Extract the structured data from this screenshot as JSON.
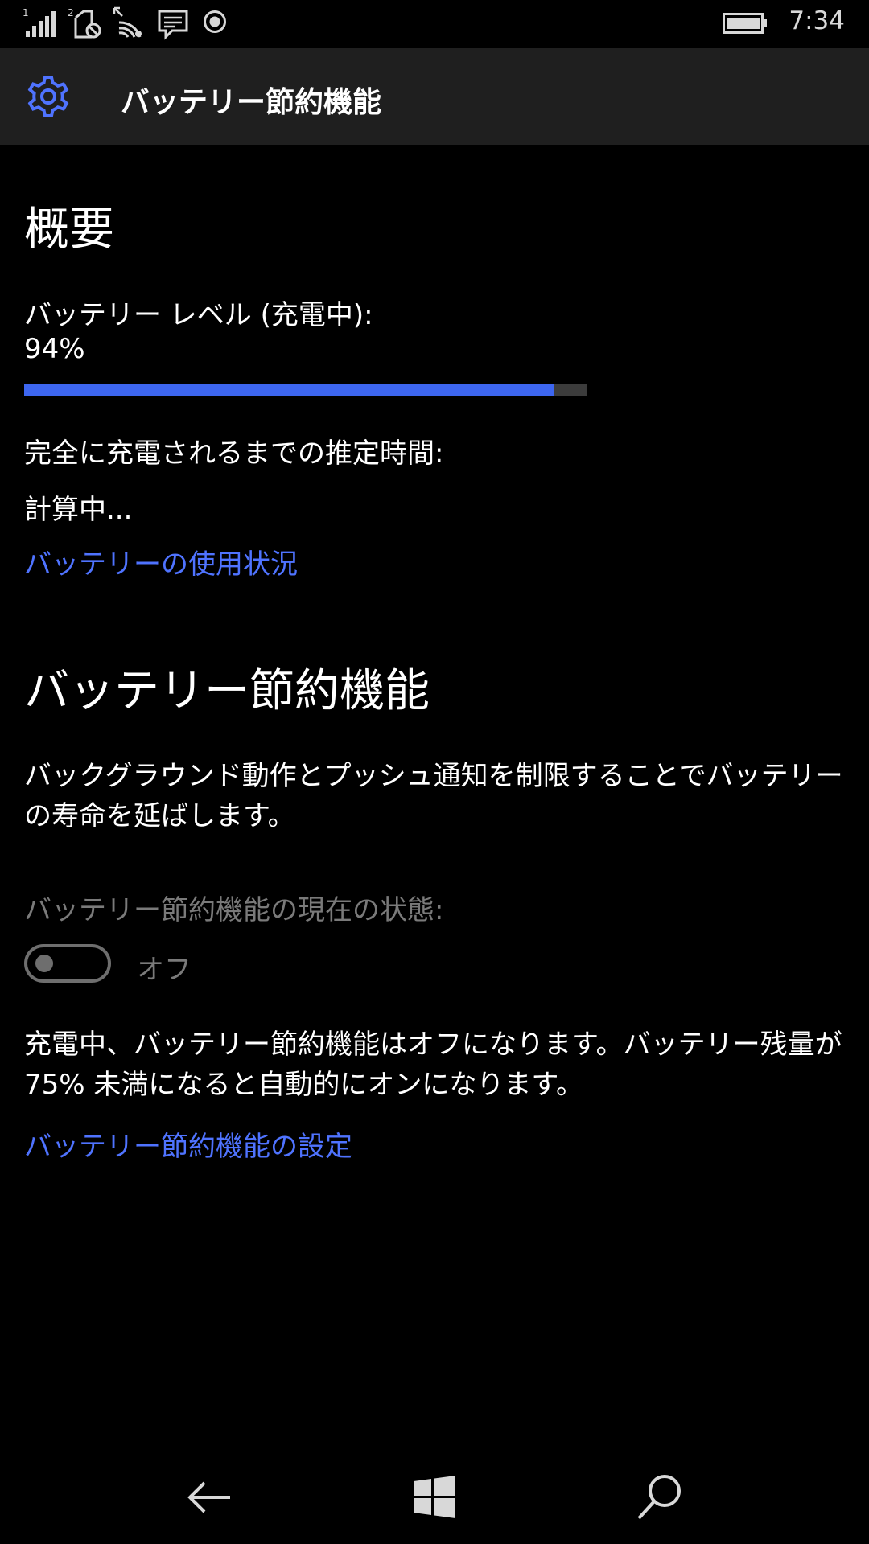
{
  "status_bar": {
    "time": "7:34",
    "sim1_label": "1",
    "sim2_label": "2",
    "icons": [
      "signal-bars-icon",
      "sim2-no-signal-icon",
      "wifi-icon",
      "message-icon",
      "record-icon",
      "battery-icon"
    ]
  },
  "header": {
    "title": "バッテリー節約機能",
    "icon": "gear-icon"
  },
  "overview": {
    "heading": "概要",
    "battery_level_label": "バッテリー レベル (充電中):",
    "battery_level_value": "94%",
    "battery_level_fraction": 0.94,
    "estimate_label": "完全に充電されるまでの推定時間:",
    "estimate_value": "計算中...",
    "usage_link": "バッテリーの使用状況"
  },
  "saver": {
    "heading": "バッテリー節約機能",
    "description": "バックグラウンド動作とプッシュ通知を制限することでバッテリーの寿命を延ばします。",
    "status_label": "バッテリー節約機能の現在の状態:",
    "toggle_state": "オフ",
    "toggle_on": false,
    "charging_note": "充電中、バッテリー節約機能はオフになります。バッテリー残量が 75% 未満になると自動的にオンになります。",
    "settings_link": "バッテリー節約機能の設定"
  },
  "navbar": {
    "icons": [
      "back-arrow-icon",
      "windows-logo-icon",
      "search-icon"
    ]
  },
  "colors": {
    "accent": "#3d66f0",
    "link": "#4f73ff",
    "header_bg": "#1f1f1f",
    "background": "#000000",
    "disabled": "#7a7a7a"
  }
}
